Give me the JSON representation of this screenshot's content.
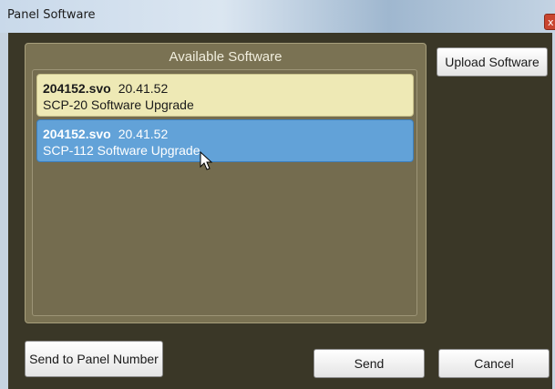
{
  "window": {
    "title": "Panel Software",
    "close_glyph": "x"
  },
  "panel": {
    "title": "Available Software"
  },
  "software_list": [
    {
      "file": "204152.svo",
      "version": "20.41.52",
      "description": "SCP-20 Software Upgrade",
      "selected": false
    },
    {
      "file": "204152.svo",
      "version": "20.41.52",
      "description": "SCP-112 Software Upgrade",
      "selected": true
    }
  ],
  "buttons": {
    "upload": "Upload Software",
    "send_to_panel": "Send to Panel Number",
    "send": "Send",
    "cancel": "Cancel"
  },
  "colors": {
    "background": "#3a3727",
    "panel": "#7a7253",
    "item_default": "#eee9b5",
    "item_selected": "#62a2d8"
  },
  "cursor_icon": "mouse-pointer-icon"
}
